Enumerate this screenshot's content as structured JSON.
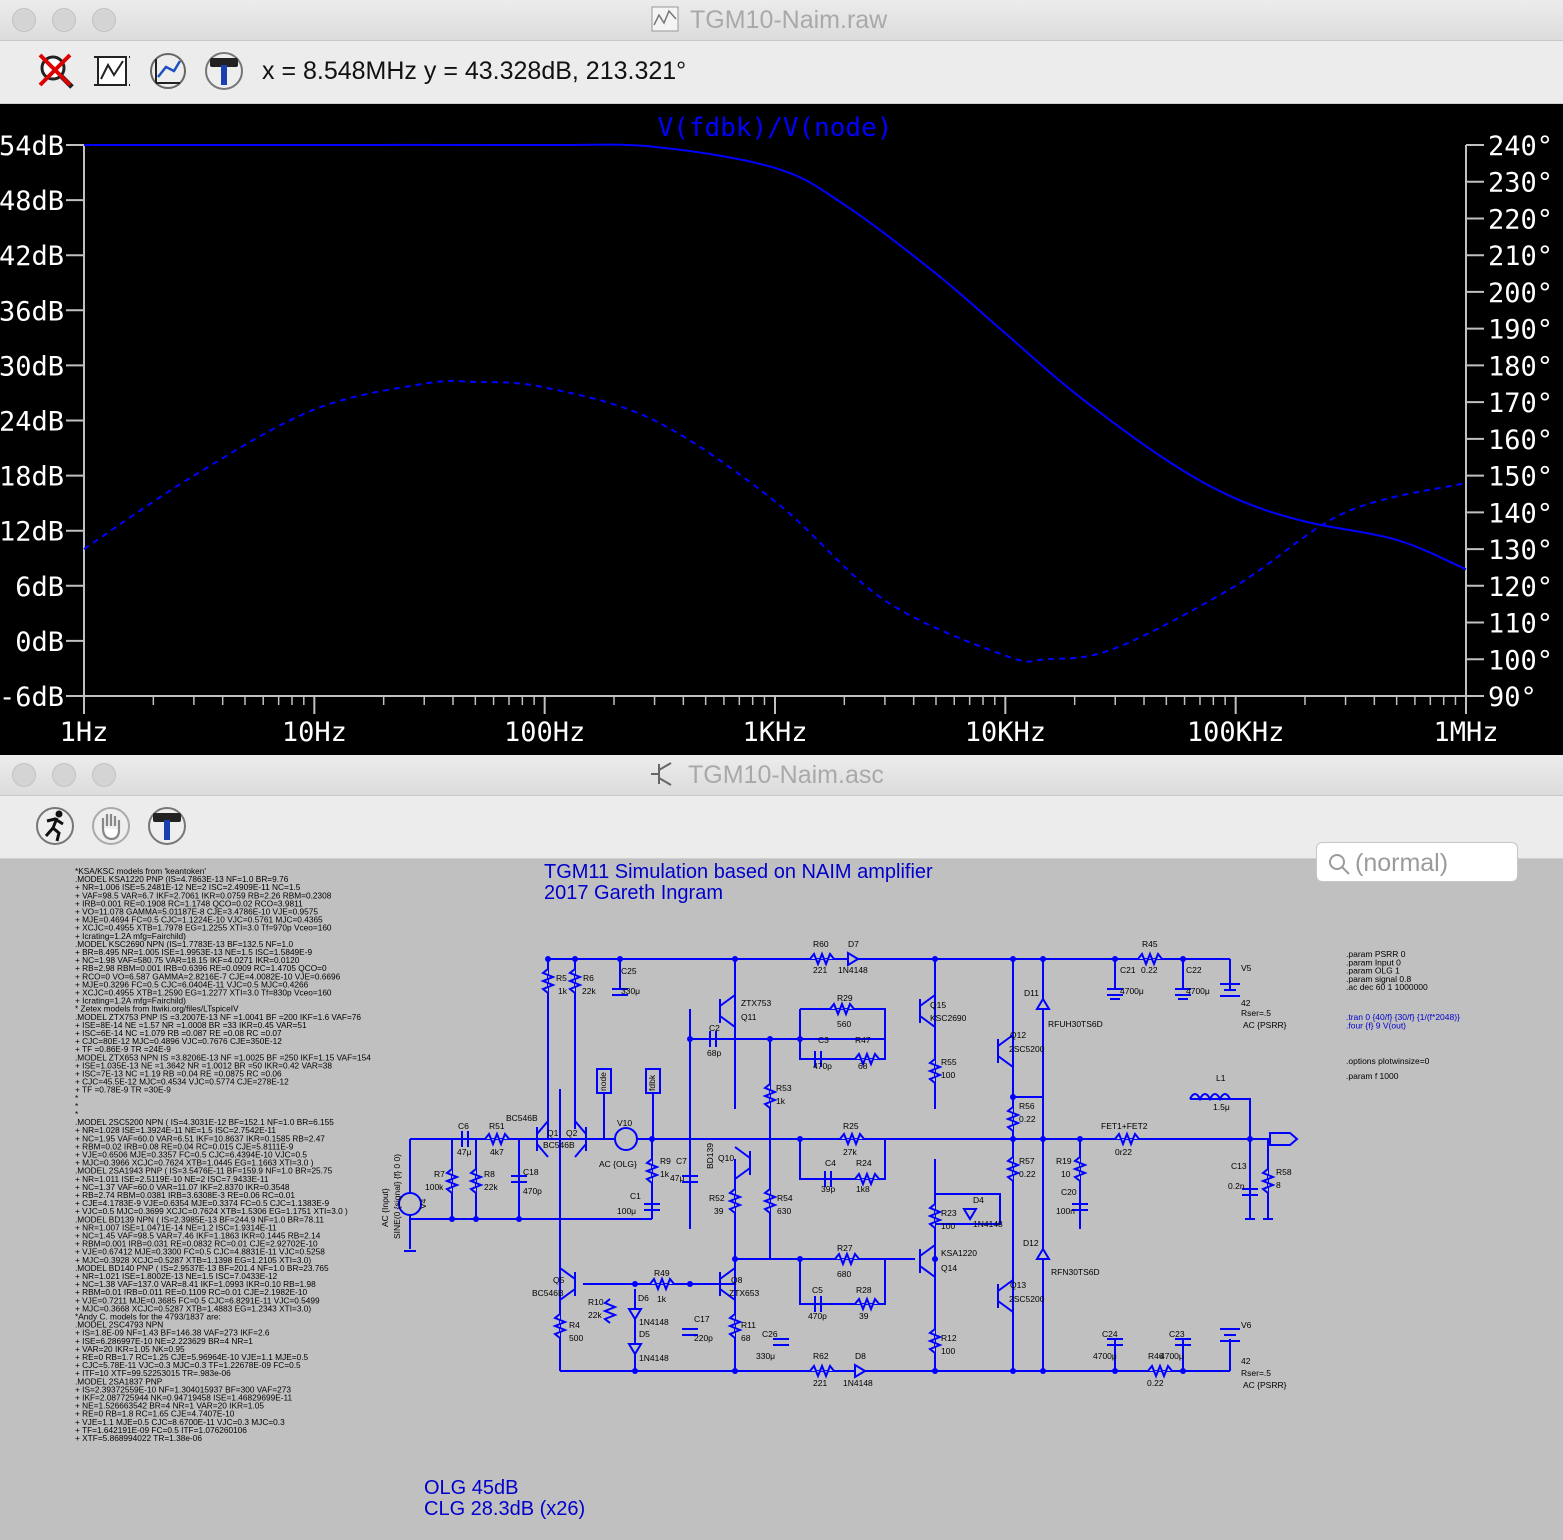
{
  "waveform_window": {
    "title": "TGM10-Naim.raw",
    "toolbar": {
      "icons": [
        "zoom-cancel-icon",
        "zoom-fit-icon",
        "autorange-icon",
        "hammer-icon"
      ]
    },
    "cursor_readout": "x = 8.548MHz    y = 43.328dB, 213.321°",
    "trace_label": "V(fdbk)/V(node)",
    "colors": {
      "background": "#000000",
      "trace": "#0000ff",
      "axes": "#c0c0c0",
      "labels": "#ffffff"
    }
  },
  "chart_data": {
    "type": "line",
    "title": "V(fdbk)/V(node)",
    "x_scale": "log",
    "x_ticks": [
      "1Hz",
      "10Hz",
      "100Hz",
      "1KHz",
      "10KHz",
      "100KHz",
      "1MHz"
    ],
    "y_left_ticks": [
      "54dB",
      "48dB",
      "42dB",
      "36dB",
      "30dB",
      "24dB",
      "18dB",
      "12dB",
      "6dB",
      "0dB",
      "-6dB"
    ],
    "y_right_ticks": [
      "240°",
      "230°",
      "220°",
      "210°",
      "200°",
      "190°",
      "180°",
      "170°",
      "160°",
      "150°",
      "140°",
      "130°",
      "120°",
      "110°",
      "100°",
      "90°"
    ],
    "xlim": [
      1,
      1000000
    ],
    "ylim_left": [
      -6,
      54
    ],
    "ylim_right": [
      90,
      240
    ],
    "series": [
      {
        "style": "solid",
        "axis": "left",
        "x": [
          1,
          10,
          100,
          300,
          1000,
          2000,
          5000,
          10000,
          20000,
          50000,
          100000,
          200000,
          500000,
          1000000
        ],
        "y": [
          54,
          54,
          54,
          53.8,
          51.5,
          47.5,
          40,
          33.5,
          27,
          19.7,
          15.5,
          13,
          11,
          7.8
        ]
      },
      {
        "style": "dashed",
        "axis": "right",
        "x": [
          1,
          3,
          10,
          30,
          50,
          100,
          300,
          1000,
          3000,
          10000,
          15000,
          30000,
          100000,
          300000,
          1000000
        ],
        "y": [
          130,
          150,
          168,
          175,
          175.5,
          174,
          165,
          143,
          116,
          101,
          100,
          103,
          120,
          140,
          148
        ]
      }
    ]
  },
  "schematic_window": {
    "title": "TGM10-Naim.asc",
    "toolbar": {
      "icons": [
        "run-icon",
        "pan-hand-icon",
        "hammer-icon"
      ]
    },
    "search_placeholder": "(normal)",
    "heading_line1": "TGM11 Simulation based on NAIM amplifier",
    "heading_line2": "2017 Gareth Ingram",
    "footer_line1": "OLG 45dB",
    "footer_line2": "CLG 28.3dB (x26)",
    "models_text": [
      "*KSA/KSC models from 'keantoken'",
      ".MODEL KSA1220 PNP (IS=4.7863E-13 NF=1.0 BR=9.76",
      "+ NR=1.006 ISE=5.2481E-12 NE=2 ISC=2.4909E-11 NC=1.5",
      "+ VAF=98.5 VAR=6.7 IKF=2.7061 IKR=0.0759 RB=2.26 RBM=0.2308",
      "+ IRB=0.001 RE=0.1908 RC=1.1748 QCO=0.02 RCO=3.9811",
      "+ VO=11.078 GAMMA=5.01187E-8 CJE=3.4786E-10 VJE=0.9575",
      "+ MJE=0.4694 FC=0.5 CJC=1.1224E-10 VJC=0.5761 MJC=0.4365",
      "+ XCJC=0.4955 XTB=1.7978 EG=1.2255 XTI=3.0 Tf=970p Vceo=160",
      "+ Icrating=1.2A mfg=Fairchild)",
      "",
      ".MODEL KSC2690 NPN (IS=1.7783E-13 BF=132.5 NF=1.0",
      "+ BR=8.495 NR=1.005 ISE=1.9953E-13 NE=1.5 ISC=1.5849E-9",
      "+ NC=1.98 VAF=580.75 VAR=18.15 IKF=4.0271 IKR=0.0120",
      "+ RB=2.98 RBM=0.001 IRB=0.6396 RE=0.0909 RC=1.4705 QCO=0",
      "+ RCO=0 VO=6.587 GAMMA=2.8216E-7 CJE=4.0082E-10 VJE=0.6696",
      "+ MJE=0.3296 FC=0.5 CJC=6.0404E-11 VJC=0.5 MJC=0.4266",
      "+ XCJC=0.4955 XTB=1.2590 EG=1.2277 XTI=3.0 Tf=830p Vceo=160",
      "+ Icrating=1.2A mfg=Fairchild)",
      "",
      "* Zetex models from ltwiki.org/files/LTspiceIV",
      ".MODEL ZTX753 PNP IS =3.2007E-13 NF =1.0041 BF =200 IKF=1.6 VAF=76",
      "+ ISE=8E-14 NE =1.57 NR =1.0008 BR =33 IKR=0.45 VAR=51",
      "+ ISC=6E-14 NC =1.079 RB =0.087 RE =0.08 RC =0.07",
      "+ CJC=80E-12 MJC=0.4896 VJC=0.7676 CJE=350E-12",
      "+ TF =0.86E-9 TR =24E-9",
      "",
      ".MODEL ZTX653 NPN IS =3.8206E-13 NF =1.0025 BF =250 IKF=1.15 VAF=154",
      "+ ISE=1.035E-13 NE =1.3642 NR =1.0012 BR =50 IKR=0.42 VAR=38",
      "+ ISC=7E-13 NC =1.19 RB =0.04 RE =0.0875 RC =0.06",
      "+ CJC=45.5E-12 MJC=0.4534 VJC=0.5774 CJE=278E-12",
      "+ TF =0.78E-9 TR =30E-9",
      "*",
      "*",
      "*",
      ".MODEL 2SC5200 NPN ( IS=4.3031E-12 BF=152.1 NF=1.0 BR=6.155",
      "+ NR=1.028 ISE=1.3924E-11 NE=1.5 ISC=2.7542E-11",
      "+ NC=1.95 VAF=60.0 VAR=6.51 IKF=10.8637 IKR=0.1585 RB=2.47",
      "+ RBM=0.02 IRB=0.08 RE=0.04 RC=0.015 CJE=5.8111E-9",
      "+ VJE=0.6506 MJE=0.3357 FC=0.5 CJC=6.4394E-10 VJC=0.5",
      "+ MJC=0.3966 XCJC=0.7624 XTB=1.0445 EG=1.1663 XTI=3.0 )",
      "",
      ".MODEL 2SA1943 PNP ( IS=3.5476E-11 BF=159.9 NF=1.0 BR=25.75",
      "+ NR=1.011 ISE=2.5119E-10 NE=2 ISC=7.9433E-11",
      "+ NC=1.37 VAF=60.0 VAR=11.07 IKF=2.8370 IKR=0.3548",
      "+ RB=2.74 RBM=0.0381 IRB=3.6308E-3 RE=0.06 RC=0.01",
      "+ CJE=4.1783E-9 VJE=0.6354 MJE=0.3374 FC=0.5 CJC=1.1383E-9",
      "+ VJC=0.5 MJC=0.3699 XCJC=0.7624 XTB=1.5306 EG=1.1751 XTI=3.0 )",
      "",
      ".MODEL BD139 NPN ( IS=2.3985E-13 BF=244.9 NF=1.0 BR=78.11",
      "+ NR=1.007 ISE=1.0471E-14 NE=1.2 ISC=1.9314E-11",
      "+ NC=1.45 VAF=98.5 VAR=7.46 IKF=1.1863 IKR=0.1445 RB=2.14",
      "+ RBM=0.001 IRB=0.031 RE=0.0832 RC=0.01 CJE=2.92702E-10",
      "+ VJE=0.67412 MJE=0.3300 FC=0.5 CJC=4.8831E-11 VJC=0.5258",
      "+ MJC=0.3928 XCJC=0.5287 XTB=1.1398 EG=1.2105 XTI=3.0)",
      "",
      ".MODEL BD140 PNP ( IS=2.9537E-13 BF=201.4 NF=1.0 BR=23.765",
      "+ NR=1.021 ISE=1.8002E-13 NE=1.5 ISC=7.0433E-12",
      "+ NC=1.38 VAF=137.0 VAR=8.41 IKF=1.0993 IKR=0.10 RB=1.98",
      "+ RBM=0.01 IRB=0.011 RE=0.1109 RC=0.01 CJE=2.1982E-10",
      "+ VJE=0.7211 MJE=0.3685 FC=0.5 CJC=6.8291E-11 VJC=0.5499",
      "+ MJC=0.3668 XCJC=0.5287 XTB=1.4883 EG=1.2343 XTI=3.0)",
      "",
      "*Andy C. models for the 4793/1837 are:",
      ".MODEL 2SC4793 NPN",
      "+ IS=1.8E-09 NF=1.43 BF=146.38 VAF=273 IKF=2.6",
      "+ ISE=6.286997E-10 NE=2.223629 BR=4 NR=1",
      "+ VAR=20 IKR=1.05 NK=0.95",
      "+ RE=0 RB=1.7 RC=1.25 CJE=5.96964E-10 VJE=1.1 MJE=0.5",
      "+ CJC=5.78E-11 VJC=0.3 MJC=0.3 TF=1.22678E-09 FC=0.5",
      "+ ITF=10 XTF=99.52253015 TR=.983e-06",
      "",
      ".MODEL 2SA1837 PNP",
      "+ IS=2.39372559E-10 NF=1.304015937 BF=300 VAF=273",
      "+ IKF=2.087725944 NK=0.94719458 ISE=1.46829699E-11",
      "+ NE=1.526663542 BR=4 NR=1 VAR=20 IKR=1.05",
      "+ RE=0 RB=1.8 RC=1.65 CJE=4.7407E-10",
      "+ VJE=1.1 MJE=0.5 CJC=8.6700E-11 VJC=0.3 MJC=0.3",
      "+ TF=1.642191E-09 FC=0.5 ITF=1.076260106",
      "+ XTF=5.868994022 TR=1.38e-06"
    ],
    "directives_black": [
      ".param PSRR 0",
      ".param Input 0",
      ".param OLG 1",
      ".param signal 0.8",
      ".ac dec 60 1 1000000"
    ],
    "directives_blue": [
      ".tran 0 {40/f} {30/f} {1/(f*2048)}",
      ".four {f} 9 V(out)"
    ],
    "directives_black2": [
      ".options plotwinsize=0",
      ".param f 1000"
    ],
    "labels": {
      "R5": "R5",
      "R5v": "1k",
      "R6": "R6",
      "R6v": "22k",
      "C25": "C25",
      "C25v": "330μ",
      "R60": "R60",
      "R60v": "221",
      "D7": "D7",
      "D7v": "1N4148",
      "ZTX753": "ZTX753",
      "Q11": "Q11",
      "R29": "R29",
      "R29v": "560",
      "Q15": "Q15",
      "KSC2690": "KSC2690",
      "C2": "C2",
      "C2v": "68p",
      "C3": "C3",
      "C3v": "470p",
      "R47": "R47",
      "R47v": "68",
      "R55": "R55",
      "R55v": "100",
      "Q12": "Q12",
      "Q12t": "2SC5200",
      "D11": "D11",
      "D11v": "RFUH30TS6D",
      "C21": "C21",
      "C21v": "4700μ",
      "R45": "R45",
      "R45v": "0.22",
      "C22": "C22",
      "C22v": "4700μ",
      "V5": "V5",
      "V5v": "42",
      "V5r": "Rser=.5",
      "V5ac": "AC {PSRR}",
      "node": "node",
      "fdbk": "fdbk",
      "BC546B": "BC546B",
      "Q1": "Q1",
      "Q2": "Q2",
      "BC546B2": "BC546B",
      "V10": "V10",
      "V10ac": "AC {OLG}",
      "R53": "R53",
      "R53v": "1k",
      "R56": "R56",
      "R56v": "0.22",
      "L1": "L1",
      "L1v": "1.5μ",
      "C6": "C6",
      "C6v": "47μ",
      "R51": "R51",
      "R51v": "4k7",
      "R25": "R25",
      "R25v": "27k",
      "FET": "FET1+FET2",
      "FETv": "0r22",
      "OUT": "OUT",
      "R7": "R7",
      "R7v": "100k",
      "R8": "R8",
      "R8v": "22k",
      "C18": "C18",
      "C18v": "470p",
      "R9": "R9",
      "R9v": "1k",
      "C7": "C7",
      "C7v": "47μ",
      "Q10": "Q10",
      "BD139": "BD139",
      "C4": "C4",
      "C4v": "39p",
      "R24": "R24",
      "R24v": "1k8",
      "R57": "R57",
      "R57v": "0.22",
      "R19": "R19",
      "R19v": "10",
      "C20": "C20",
      "C20v": "100n",
      "C13": "C13",
      "C13v": "0.2n",
      "R58": "R58",
      "R58v": "8",
      "V4": "V4",
      "V4src": "SINE(0 {signal} {f} 0 0)",
      "V4ac": "AC {Input}",
      "C1": "C1",
      "C1v": "100μ",
      "R52": "R52",
      "R52v": "39",
      "R54": "R54",
      "R54v": "630",
      "R23": "R23",
      "R23v": "100",
      "D4": "D4",
      "D4v": "1N4148",
      "D12": "D12",
      "D12v": "RFN30TS6D",
      "R27": "R27",
      "R27v": "680",
      "KSA1220": "KSA1220",
      "Q14": "Q14",
      "Q5": "Q5",
      "Q5t": "BC546B",
      "R49": "R49",
      "R49v": "1k",
      "Q8": "Q8",
      "Q8t": "ZTX653",
      "D6": "D6",
      "D6v": "1N4148",
      "R10": "R10",
      "R10v": "22k",
      "C5": "C5",
      "C5v": "470p",
      "R28": "R28",
      "R28v": "39",
      "Q13": "Q13",
      "Q13t": "2SC5200",
      "R4": "R4",
      "R4v": "500",
      "D5": "D5",
      "D5v": "1N4148",
      "C17": "C17",
      "C17v": "220p",
      "R11": "R11",
      "R11v": "68",
      "C26": "C26",
      "C26v": "330μ",
      "R12": "R12",
      "R12v": "100",
      "C24": "C24",
      "C24v": "4700μ",
      "C23": "C23",
      "C23v": "4700μ",
      "V6": "V6",
      "V6v": "42",
      "V6r": "Rser=.5",
      "V6ac": "AC {PSRR}",
      "R62": "R62",
      "R62v": "221",
      "D8": "D8",
      "D8v": "1N4148",
      "R46": "R46",
      "R46v": "0.22"
    }
  }
}
